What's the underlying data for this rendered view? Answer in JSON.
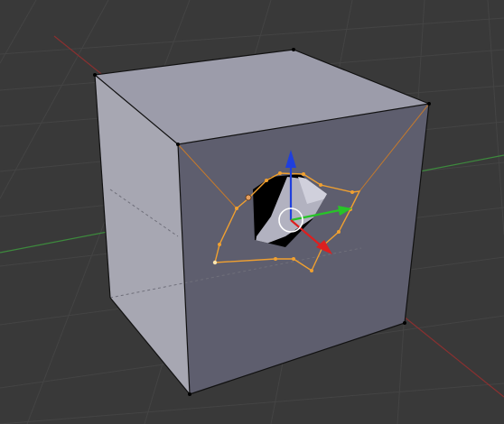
{
  "viewport": {
    "name": "3D View",
    "background_color": "#393939",
    "grid_line_color": "#444444",
    "x_axis_color": "#8a3030",
    "y_axis_color": "#3d8a3d"
  },
  "object": {
    "type": "cube",
    "mode": "edit",
    "face_color_front": "#5e5e6e",
    "face_color_top": "#9c9caa",
    "face_color_left": "#a7a7b2",
    "edge_color": "#111111",
    "selection_color": "#f0a030"
  },
  "gizmo": {
    "x_color": "#dd1f1f",
    "y_color": "#28c428",
    "z_color": "#1f3fdd",
    "center_ring_color": "#ffffff"
  }
}
